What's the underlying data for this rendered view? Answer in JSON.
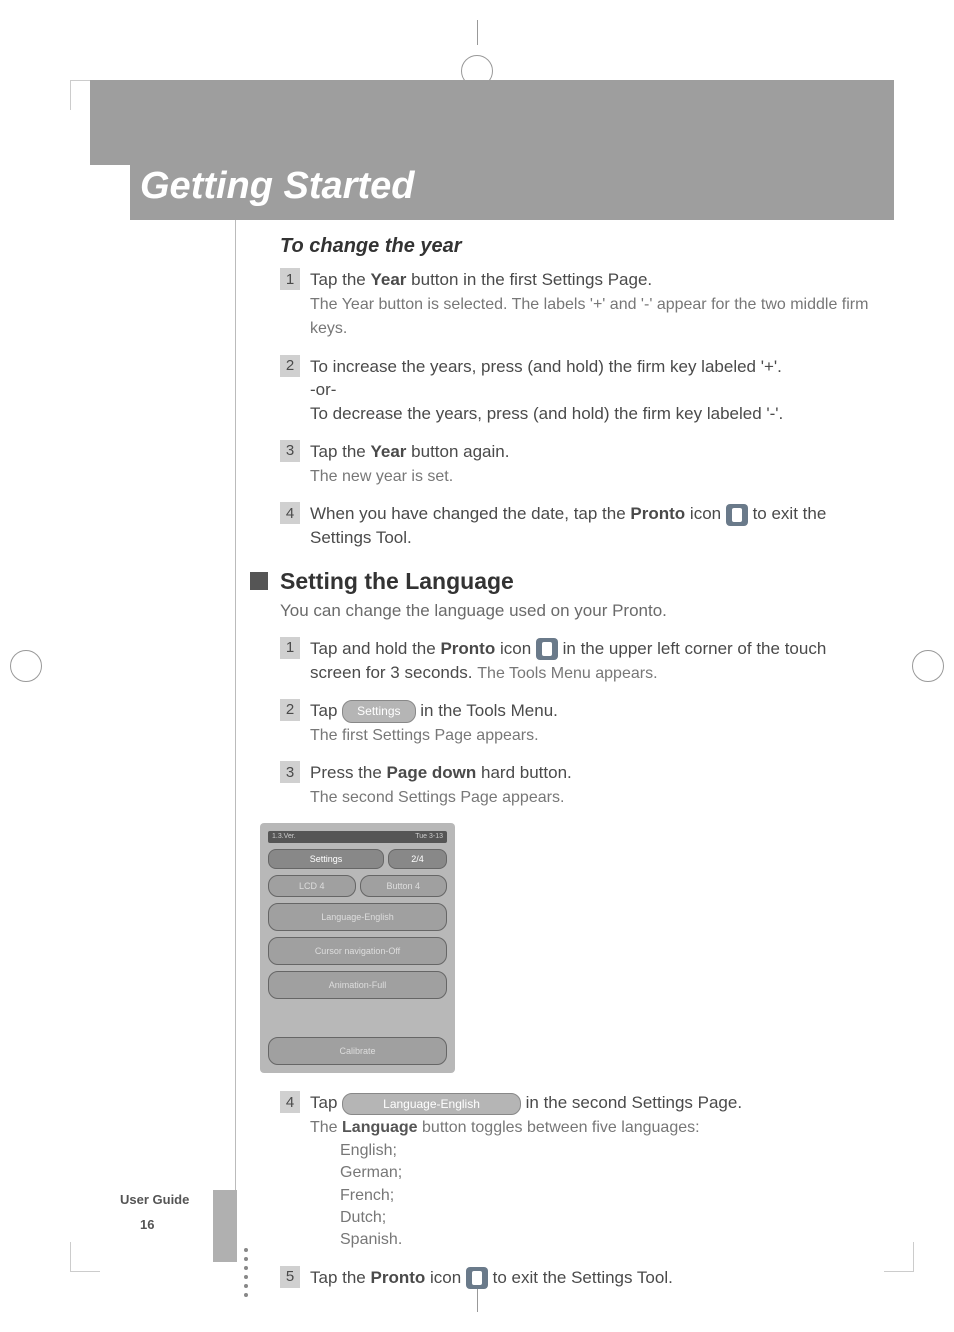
{
  "chapter_title": "Getting Started",
  "sub1": {
    "heading": "To change the year",
    "steps": [
      {
        "num": "1",
        "main_pre": "Tap the ",
        "bold": "Year",
        "main_post": " button in the first Settings Page.",
        "sub": "The Year button is selected. The labels '+' and '-' appear for the two middle firm keys."
      },
      {
        "num": "2",
        "line1": "To increase the years, press (and hold) the firm key labeled '+'.",
        "line2": "-or-",
        "line3": "To decrease the years, press (and hold) the firm key labeled '-'."
      },
      {
        "num": "3",
        "main_pre": "Tap the ",
        "bold": "Year",
        "main_post": " button again.",
        "sub": "The new year is set."
      },
      {
        "num": "4",
        "pre": "When you have changed the date, tap the ",
        "bold": "Pronto",
        "mid": " icon ",
        "post": " to exit the Settings Tool."
      }
    ]
  },
  "section2": {
    "title": "Setting the Language",
    "intro": "You can change the language used on your Pronto.",
    "steps": [
      {
        "num": "1",
        "pre": "Tap and hold the ",
        "bold": "Pronto",
        "mid": " icon ",
        "post": " in the upper left corner of the touch screen for 3 seconds. ",
        "sub_inline": "The Tools Menu appears."
      },
      {
        "num": "2",
        "pre": "Tap ",
        "btn": "Settings",
        "post": " in the Tools Menu.",
        "sub": "The first Settings Page appears."
      },
      {
        "num": "3",
        "pre": "Press the ",
        "bold": "Page down",
        "post": " hard button.",
        "sub": "The second Settings Page appears."
      },
      {
        "num": "4",
        "pre": "Tap ",
        "btn": "Language-English",
        "post": " in the second Settings Page.",
        "sub_pre": "The ",
        "sub_bold": "Language",
        "sub_post": " button toggles between five languages:",
        "langs": [
          "English;",
          "German;",
          "French;",
          "Dutch;",
          "Spanish."
        ]
      },
      {
        "num": "5",
        "pre": "Tap the ",
        "bold": "Pronto",
        "mid": " icon ",
        "post": " to exit the Settings Tool."
      }
    ]
  },
  "screenshot": {
    "header_left": "1.3.Ver.",
    "header_right": "Tue 3-13",
    "tab1": "Settings",
    "tab2": "2/4",
    "lcd": "LCD     4",
    "button": "Button   4",
    "lang": "Language-English",
    "cursor": "Cursor navigation-Off",
    "anim": "Animation-Full",
    "calib": "Calibrate"
  },
  "footer": {
    "label": "User Guide",
    "page": "16"
  }
}
